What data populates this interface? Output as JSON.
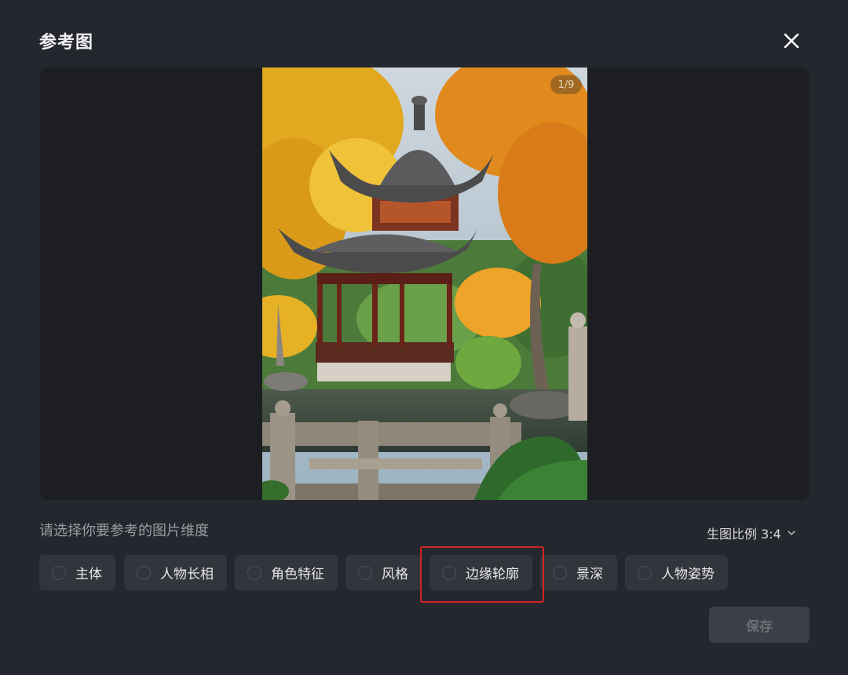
{
  "dialog": {
    "title": "参考图",
    "close_icon": "close-icon"
  },
  "preview": {
    "counter": "1/9",
    "image_description": "Chinese pagoda pavilion among autumn ginkgo and maple trees beside a pond with stone bridge railing"
  },
  "selection": {
    "prompt": "请选择你要参考的图片维度",
    "ratio_label": "生图比例 3:4",
    "ratio_icon": "chevron-down-icon",
    "options": [
      {
        "label": "主体",
        "checked": false
      },
      {
        "label": "人物长相",
        "checked": false
      },
      {
        "label": "角色特征",
        "checked": false
      },
      {
        "label": "风格",
        "checked": false
      },
      {
        "label": "边缘轮廓",
        "checked": false,
        "highlighted": true
      },
      {
        "label": "景深",
        "checked": false
      },
      {
        "label": "人物姿势",
        "checked": false
      }
    ]
  },
  "footer": {
    "save_label": "保存",
    "save_enabled": false
  },
  "colors": {
    "background": "#25272e",
    "preview_bg": "#1d1e21",
    "option_bg": "#33353c",
    "highlight": "#d62424",
    "save_bg_disabled": "#3d3f46"
  }
}
